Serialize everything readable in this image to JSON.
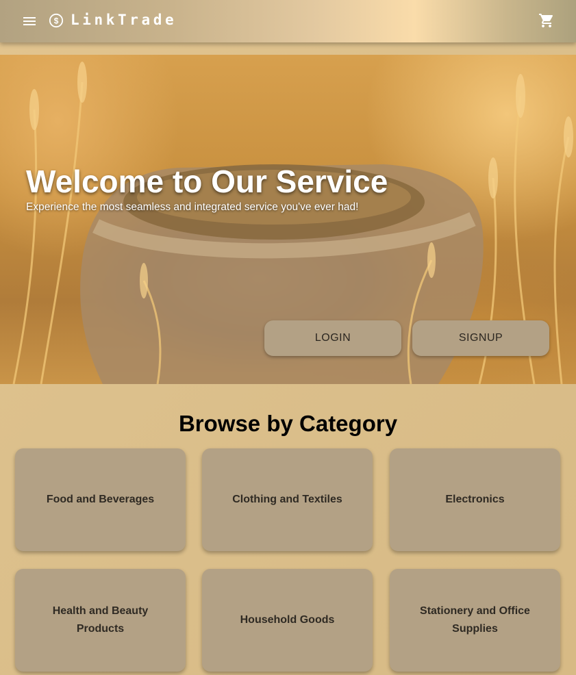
{
  "app": {
    "brand": "LinkTrade",
    "icons": {
      "menu": "menu-icon",
      "logo": "dollar-coin-icon",
      "cart": "shopping-cart-icon"
    }
  },
  "hero": {
    "title": "Welcome to Our Service",
    "subtitle": "Experience the most seamless and integrated service you've ever had!",
    "login_label": "LOGIN",
    "signup_label": "SIGNUP"
  },
  "categories": {
    "heading": "Browse by Category",
    "items": [
      {
        "label": "Food and Beverages"
      },
      {
        "label": "Clothing and Textiles"
      },
      {
        "label": "Electronics"
      },
      {
        "label": "Health and Beauty Products"
      },
      {
        "label": "Household Goods"
      },
      {
        "label": "Stationery and Office Supplies"
      }
    ]
  },
  "colors": {
    "card": "#b3a185",
    "page_background": "#dcc08c",
    "text_dark": "#2f2a23"
  }
}
